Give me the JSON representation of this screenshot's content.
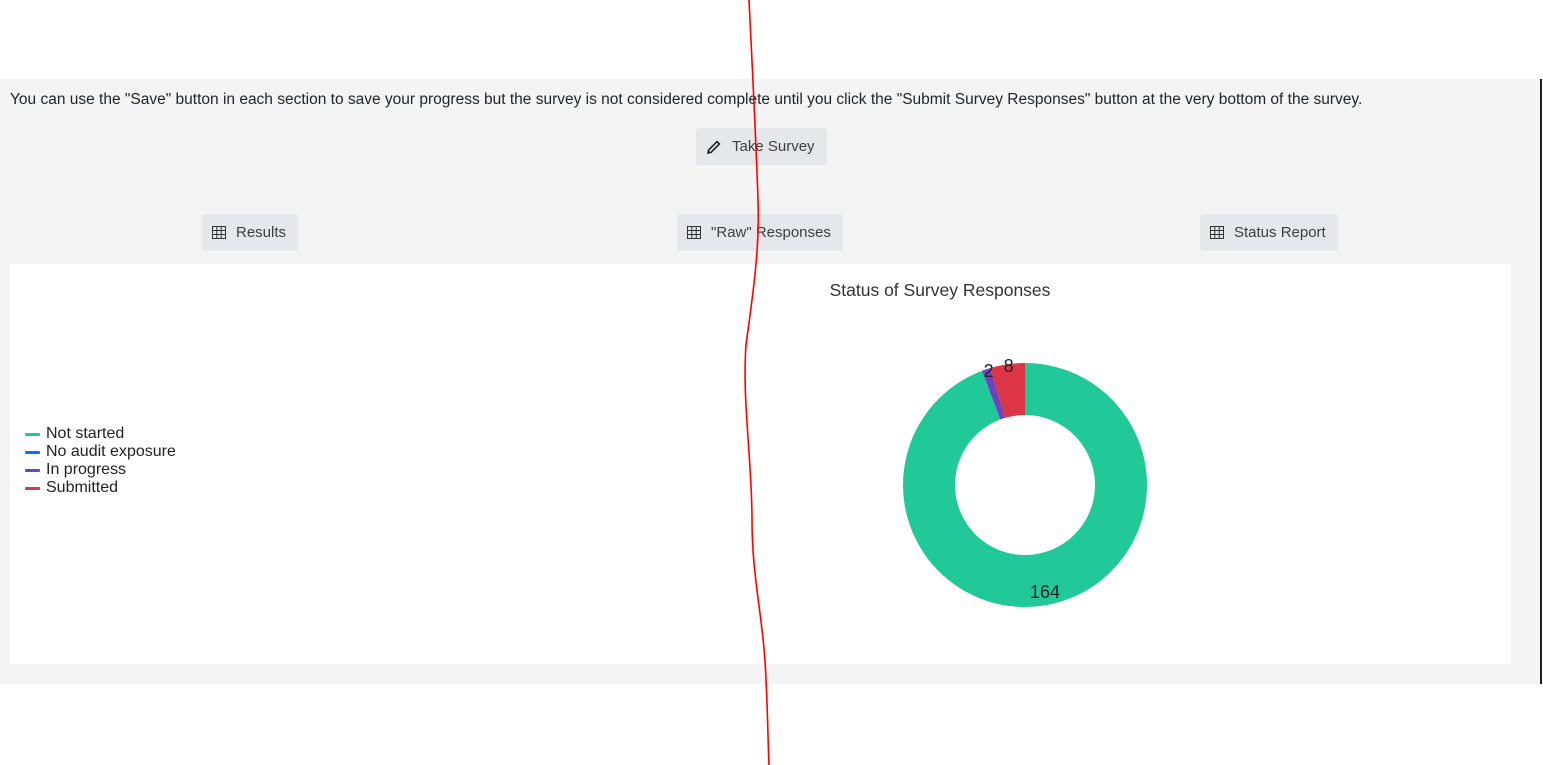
{
  "notice_text": "You can use the \"Save\" button in each section to save your progress but the survey is not considered complete until you click the \"Submit Survey Responses\" button at the very bottom of the survey.",
  "buttons": {
    "take_survey": "Take Survey",
    "results": "Results",
    "raw_responses": "\"Raw\" Responses",
    "status_report": "Status Report"
  },
  "colors": {
    "not_started": "#20c997",
    "no_audit_exposure": "#0d6efd",
    "in_progress": "#6f42c1",
    "submitted": "#dc3545",
    "annotation_line": "#ff0000"
  },
  "chart_data": {
    "type": "pie",
    "donut": true,
    "title": "Status of Survey Responses",
    "legend_position": "left",
    "series": [
      {
        "name": "Not started",
        "value": 164
      },
      {
        "name": "No audit exposure",
        "value": 0
      },
      {
        "name": "In progress",
        "value": 2
      },
      {
        "name": "Submitted",
        "value": 8
      }
    ]
  }
}
